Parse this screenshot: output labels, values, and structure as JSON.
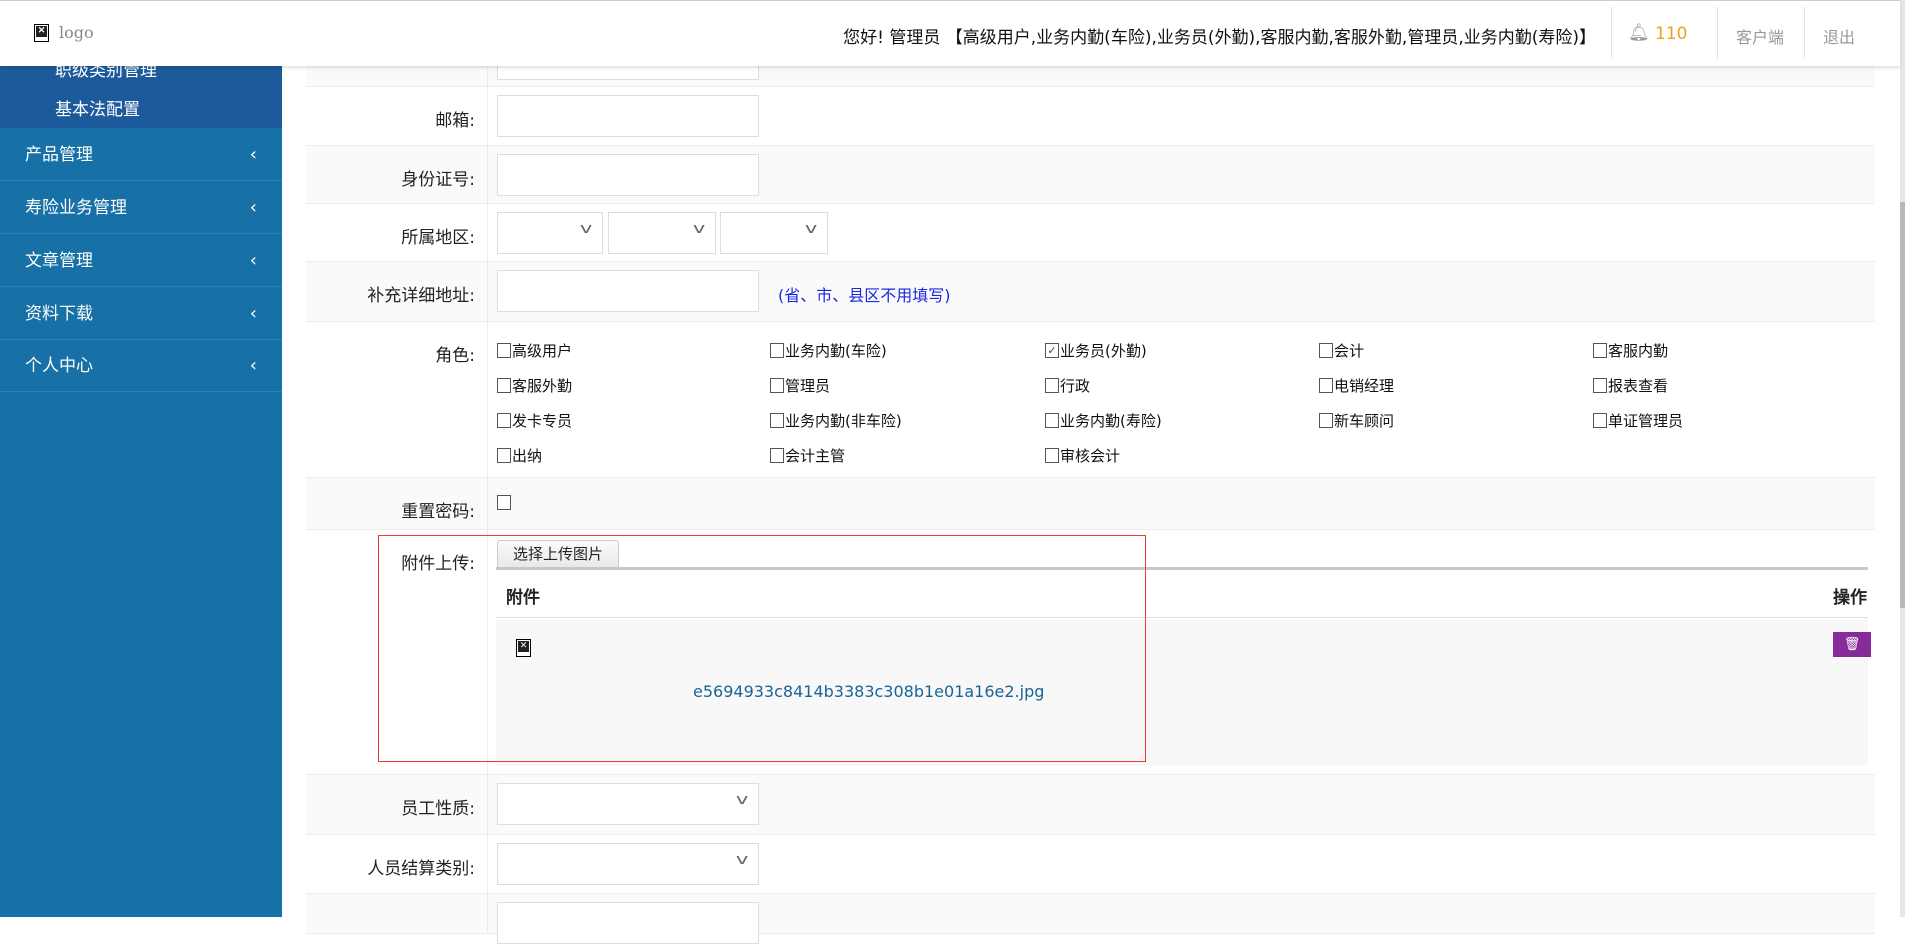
{
  "header": {
    "logo_text": "logo",
    "greeting": "您好!  管理员 【高级用户,业务内勤(车险),业务员(外勤),客服内勤,客服外勤,管理员,业务内勤(寿险)】",
    "notification_count": "110",
    "client_link": "客户端",
    "logout_link": "退出"
  },
  "sidebar": {
    "submenu": [
      "职级类别管理",
      "基本法配置"
    ],
    "items": [
      {
        "label": "产品管理"
      },
      {
        "label": "寿险业务管理"
      },
      {
        "label": "文章管理"
      },
      {
        "label": "资料下载"
      },
      {
        "label": "个人中心"
      }
    ]
  },
  "form": {
    "email_label": "邮箱:",
    "id_label": "身份证号:",
    "region_label": "所属地区:",
    "address_label": "补充详细地址:",
    "address_hint": "(省、市、县区不用填写)",
    "roles_label": "角色:",
    "roles": [
      {
        "label": "高级用户",
        "checked": false
      },
      {
        "label": "业务内勤(车险)",
        "checked": false
      },
      {
        "label": "业务员(外勤)",
        "checked": true
      },
      {
        "label": "会计",
        "checked": false
      },
      {
        "label": "客服内勤",
        "checked": false
      },
      {
        "label": "客服外勤",
        "checked": false
      },
      {
        "label": "管理员",
        "checked": false
      },
      {
        "label": "行政",
        "checked": false
      },
      {
        "label": "电销经理",
        "checked": false
      },
      {
        "label": "报表查看",
        "checked": false
      },
      {
        "label": "发卡专员",
        "checked": false
      },
      {
        "label": "业务内勤(非车险)",
        "checked": false
      },
      {
        "label": "业务内勤(寿险)",
        "checked": false
      },
      {
        "label": "新车顾问",
        "checked": false
      },
      {
        "label": "单证管理员",
        "checked": false
      },
      {
        "label": "出纳",
        "checked": false
      },
      {
        "label": "会计主管",
        "checked": false
      },
      {
        "label": "审核会计",
        "checked": false
      }
    ],
    "reset_password_label": "重置密码:",
    "attachment_label": "附件上传:",
    "upload_button": "选择上传图片",
    "col_attachment": "附件",
    "col_action": "操作",
    "file_name": "e5694933c8414b3383c308b1e01a16e2.jpg",
    "employee_type_label": "员工性质:",
    "settlement_label": "人员结算类别:"
  },
  "colors": {
    "sidebar": "#1770a6",
    "submenu": "#1d5a9c",
    "delete": "#862b99",
    "hint": "#1b27e0",
    "badge": "#f0a020"
  }
}
